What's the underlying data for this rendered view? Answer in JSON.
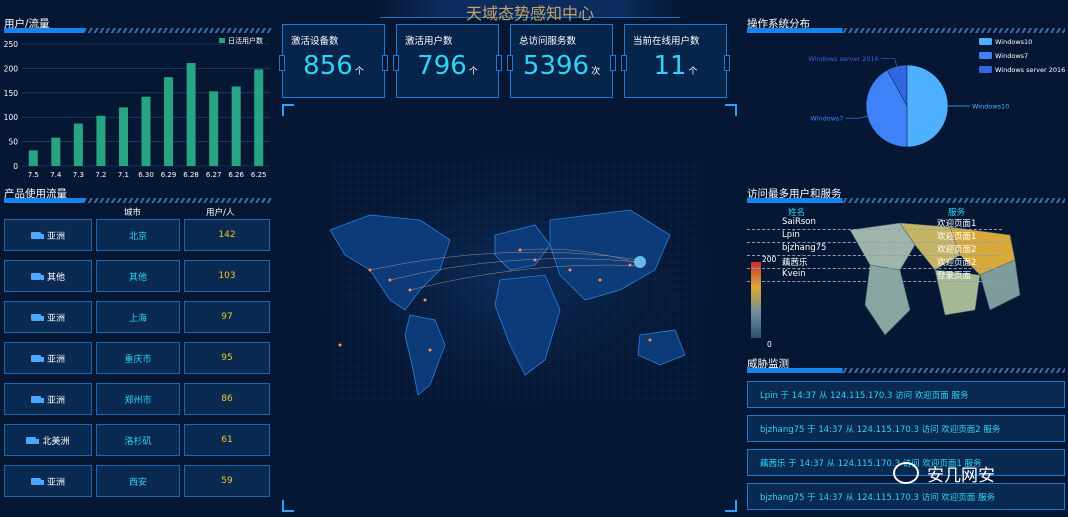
{
  "header": {
    "title": "天域态势感知中心"
  },
  "sections": {
    "user_traffic": "用户/流量",
    "product_traffic": "产品使用流量",
    "os_distribution": "操作系统分布",
    "top_users": "访问最多用户和服务",
    "threats": "威胁监测"
  },
  "kpis": [
    {
      "label": "激活设备数",
      "value": "856",
      "unit": "个"
    },
    {
      "label": "激活用户数",
      "value": "796",
      "unit": "个"
    },
    {
      "label": "总访问服务数",
      "value": "5396",
      "unit": "次"
    },
    {
      "label": "当前在线用户数",
      "value": "11",
      "unit": "个"
    }
  ],
  "chart_data": [
    {
      "type": "bar",
      "legend": "日活用户数",
      "categories": [
        "7.5",
        "7.4",
        "7.3",
        "7.2",
        "7.1",
        "6.30",
        "6.29",
        "6.28",
        "6.27",
        "6.26",
        "6.25"
      ],
      "values": [
        32,
        58,
        87,
        103,
        120,
        142,
        182,
        211,
        153,
        163,
        198
      ],
      "ylim": [
        0,
        250
      ],
      "yticks": [
        0,
        50,
        100,
        150,
        200,
        250
      ],
      "color": "#27a483"
    },
    {
      "type": "pie",
      "labels": [
        "Windows10",
        "Windows7",
        "Windows server 2016"
      ],
      "values": [
        50,
        42,
        8
      ],
      "colors": [
        "#4eb0ff",
        "#3f82f7",
        "#3466e0"
      ]
    }
  ],
  "product_table": {
    "headers": [
      "城市",
      "用户/人"
    ],
    "rows": [
      {
        "region": "亚洲",
        "city": "北京",
        "users": "142"
      },
      {
        "region": "其他",
        "city": "其他",
        "users": "103"
      },
      {
        "region": "亚洲",
        "city": "上海",
        "users": "97"
      },
      {
        "region": "亚洲",
        "city": "重庆市",
        "users": "95"
      },
      {
        "region": "亚洲",
        "city": "郑州市",
        "users": "86"
      },
      {
        "region": "北美洲",
        "city": "洛杉矶",
        "users": "61"
      },
      {
        "region": "亚洲",
        "city": "西安",
        "users": "59"
      }
    ]
  },
  "top_users": {
    "headers": [
      "姓名",
      "服务"
    ],
    "names": [
      "SaiRson",
      "Lpin",
      "bjzhang75",
      "藕茜乐",
      "Kvein"
    ],
    "services": [
      "欢迎页面1",
      "欢迎页面1",
      "欢迎页面2",
      "欢迎页面2",
      "登录页面"
    ],
    "scale_max": "200",
    "scale_min": "0"
  },
  "threats": [
    "Lpin 于 14:37 从 124.115.170.3 访问 欢迎页面 服务",
    "bjzhang75 于 14:37 从 124.115.170.3 访问 欢迎页面2 服务",
    "藕茜乐 于 14:37 从 124.115.170.3 访问 欢迎页面1 服务",
    "bjzhang75 于 14:37 从 124.115.170.3 访问 欢迎页面 服务"
  ],
  "watermark": {
    "text": "安几网安"
  },
  "colors": {
    "accent": "#2fd3f5",
    "value_yellow": "#f0c52a",
    "border": "#1b7bd6",
    "title_gold": "#c7a368"
  }
}
